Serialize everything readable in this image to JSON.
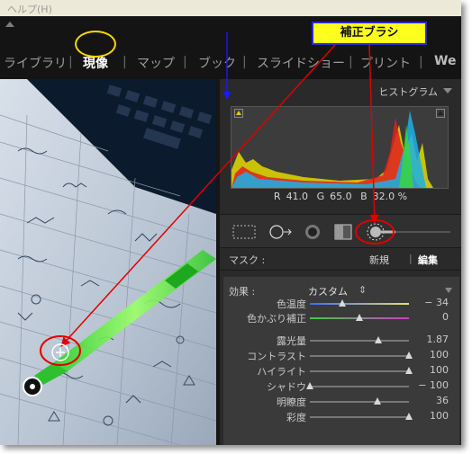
{
  "menubar": {
    "help": "ヘルプ(H)"
  },
  "modules": {
    "library": "ライブラリ",
    "develop": "現像",
    "map": "マップ",
    "book": "ブック",
    "slideshow": "スライドショー",
    "print": "プリント",
    "web": "We",
    "sep": "|"
  },
  "callout": {
    "text": "補正ブラシ"
  },
  "histogram": {
    "title": "ヒストグラム",
    "r_label": "R",
    "r_value": "41.0",
    "g_label": "G",
    "g_value": "65.0",
    "b_label": "B",
    "b_value": "32.0 %"
  },
  "mask": {
    "label": "マスク :",
    "new": "新規",
    "edit": "編集",
    "sep": "|"
  },
  "effect": {
    "label": "効果 :",
    "value": "カスタム",
    "stepper": "⇕"
  },
  "adjustments": [
    {
      "label": "色温度",
      "value": "− 34",
      "pos": 0.33
    },
    {
      "label": "色かぶり補正",
      "value": "0",
      "pos": 0.5
    },
    {
      "label": "露光量",
      "value": "1.87",
      "pos": 0.69
    },
    {
      "label": "コントラスト",
      "value": "100",
      "pos": 1.0
    },
    {
      "label": "ハイライト",
      "value": "100",
      "pos": 1.0
    },
    {
      "label": "シャドウ",
      "value": "− 100",
      "pos": 0.0
    },
    {
      "label": "明瞭度",
      "value": "36",
      "pos": 0.68
    },
    {
      "label": "彩度",
      "value": "100",
      "pos": 1.0
    }
  ],
  "colors": {
    "callout_bg": "#ffff1f",
    "annotation_red": "#e00000",
    "highlight_yellow": "#ffd700",
    "accent_blue": "#1a1aff"
  }
}
